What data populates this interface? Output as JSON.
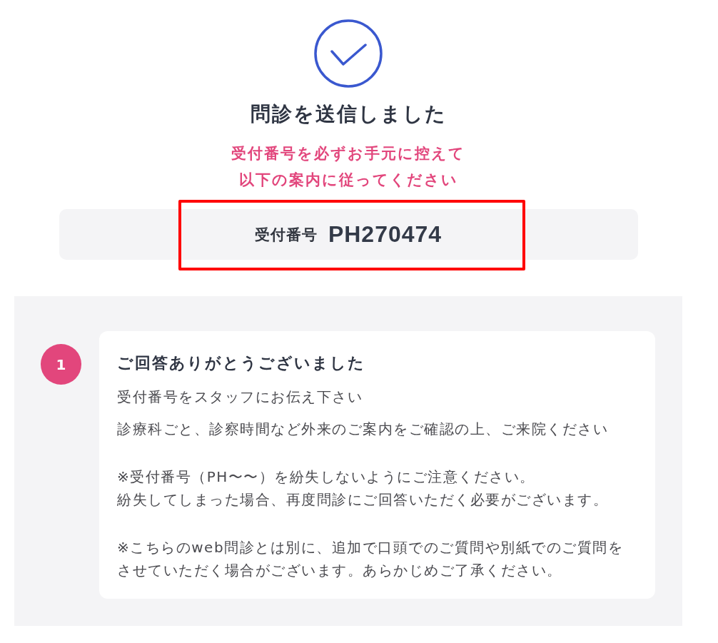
{
  "header": {
    "title": "問診を送信しました",
    "notice": [
      "受付番号を必ずお手元に控えて",
      "以下の案内に従ってください"
    ]
  },
  "receipt": {
    "label": "受付番号",
    "number": "PH270474",
    "highlighted": true
  },
  "steps": [
    {
      "number": "1",
      "title": "ご回答ありがとうございました",
      "paragraphs": [
        {
          "kind": "info",
          "lines": [
            "受付番号をスタッフにお伝え下さい"
          ]
        },
        {
          "kind": "info",
          "lines": [
            "診療科ごと、診察時間など外来のご案内をご確認の上、ご来院ください"
          ]
        },
        {
          "kind": "note",
          "lines": [
            "※受付番号（PH〜〜）を紛失しないようにご注意ください。",
            "紛失してしまった場合、再度問診にご回答いただく必要がございます。"
          ]
        },
        {
          "kind": "note",
          "lines": [
            "※こちらのweb問診とは別に、追加で口頭でのご質問や別紙でのご質問を",
            "させていただく場合がございます。あらかじめご了承ください。"
          ]
        }
      ]
    }
  ]
}
